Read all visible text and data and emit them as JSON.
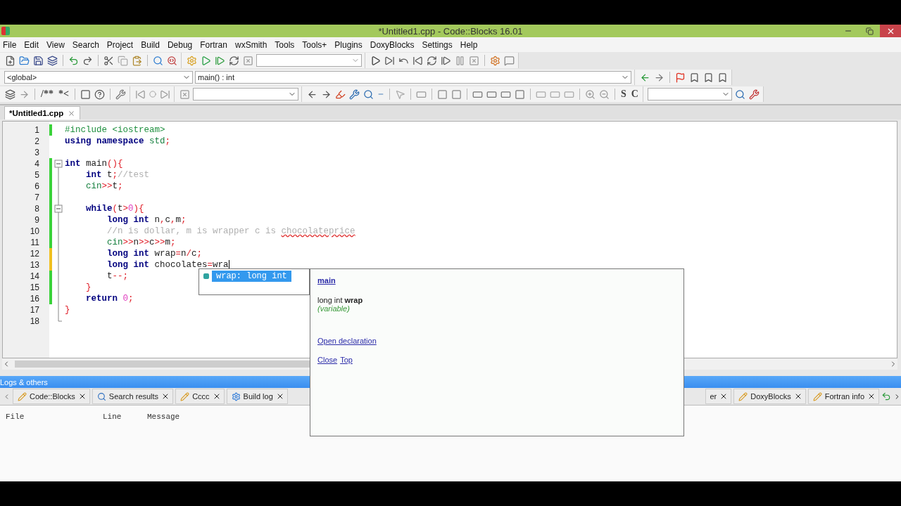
{
  "window": {
    "title": "*Untitled1.cpp - Code::Blocks 16.01"
  },
  "menu": [
    "File",
    "Edit",
    "View",
    "Search",
    "Project",
    "Build",
    "Debug",
    "Fortran",
    "wxSmith",
    "Tools",
    "Tools+",
    "Plugins",
    "DoxyBlocks",
    "Settings",
    "Help"
  ],
  "scope_bar": {
    "scope": "<global>",
    "function": "main() : int"
  },
  "toolbar_3": {
    "comment_buttons": [
      "/**",
      "*<"
    ],
    "letter_buttons": [
      "S",
      "C"
    ]
  },
  "editor_tabs": [
    {
      "label": "*Untitled1.cpp",
      "selected": true
    }
  ],
  "editor": {
    "lines": [
      {
        "number": "1",
        "modified": false,
        "tokens": [
          {
            "kind": "preprocessor",
            "text": "#include <iostream>"
          }
        ]
      },
      {
        "number": "2",
        "tokens": [
          {
            "kind": "keyword",
            "text": "using namespace "
          },
          {
            "kind": "library",
            "text": "std"
          },
          {
            "kind": "operator",
            "text": ";"
          }
        ]
      },
      {
        "number": "3"
      },
      {
        "number": "4",
        "modified": false,
        "fold": {
          "expanded": true
        },
        "tokens": [
          {
            "kind": "keyword",
            "text": "int"
          },
          {
            "kind": "plain",
            "text": " main"
          },
          {
            "kind": "operator",
            "text": "(){"
          }
        ]
      },
      {
        "number": "5",
        "modified": false,
        "tokens": [
          {
            "kind": "keyword",
            "text": "    int"
          },
          {
            "kind": "plain",
            "text": " t"
          },
          {
            "kind": "operator",
            "text": ";"
          },
          {
            "kind": "comment",
            "text": "//test"
          }
        ]
      },
      {
        "number": "6",
        "modified": false,
        "tokens": [
          {
            "kind": "library",
            "text": "    cin"
          },
          {
            "kind": "operator",
            "text": ">>"
          },
          {
            "kind": "plain",
            "text": "t"
          },
          {
            "kind": "operator",
            "text": ";"
          }
        ]
      },
      {
        "number": "7",
        "modified": false
      },
      {
        "number": "8",
        "modified": false,
        "fold": {
          "expanded": true
        },
        "tokens": [
          {
            "kind": "keyword",
            "text": "    while"
          },
          {
            "kind": "operator",
            "text": "("
          },
          {
            "kind": "plain",
            "text": "t"
          },
          {
            "kind": "operator",
            "text": ">"
          },
          {
            "kind": "number",
            "text": "0"
          },
          {
            "kind": "operator",
            "text": "){"
          }
        ]
      },
      {
        "number": "9",
        "modified": false,
        "tokens": [
          {
            "kind": "keyword",
            "text": "        long int"
          },
          {
            "kind": "plain",
            "text": " n"
          },
          {
            "kind": "operator",
            "text": ","
          },
          {
            "kind": "plain",
            "text": "c"
          },
          {
            "kind": "operator",
            "text": ","
          },
          {
            "kind": "plain",
            "text": "m"
          },
          {
            "kind": "operator",
            "text": ";"
          }
        ]
      },
      {
        "number": "10",
        "modified": false,
        "tokens": [
          {
            "kind": "comment",
            "text": "        //n is dollar, m is wrapper c is "
          },
          {
            "kind": "misspelled",
            "text": "chocolateprice"
          }
        ]
      },
      {
        "number": "11",
        "modified": false,
        "tokens": [
          {
            "kind": "library",
            "text": "        cin"
          },
          {
            "kind": "operator",
            "text": ">>"
          },
          {
            "kind": "plain",
            "text": "n"
          },
          {
            "kind": "operator",
            "text": ">>"
          },
          {
            "kind": "plain",
            "text": "c"
          },
          {
            "kind": "operator",
            "text": ">>"
          },
          {
            "kind": "plain",
            "text": "m"
          },
          {
            "kind": "operator",
            "text": ";"
          }
        ]
      },
      {
        "number": "12",
        "modified": true,
        "tokens": [
          {
            "kind": "keyword",
            "text": "        long int"
          },
          {
            "kind": "plain",
            "text": " wrap"
          },
          {
            "kind": "operator",
            "text": "="
          },
          {
            "kind": "plain",
            "text": "n"
          },
          {
            "kind": "operator",
            "text": "/"
          },
          {
            "kind": "plain",
            "text": "c"
          },
          {
            "kind": "operator",
            "text": ";"
          }
        ]
      },
      {
        "number": "13",
        "modified": true,
        "caret": true,
        "tokens": [
          {
            "kind": "keyword",
            "text": "        long int"
          },
          {
            "kind": "plain",
            "text": " chocolates"
          },
          {
            "kind": "operator",
            "text": "="
          },
          {
            "kind": "plain",
            "text": "wra"
          }
        ]
      },
      {
        "number": "14",
        "modified": false,
        "tokens": [
          {
            "kind": "plain",
            "text": "        t"
          },
          {
            "kind": "operator",
            "text": "--;"
          }
        ]
      },
      {
        "number": "15",
        "modified": false,
        "tokens": [
          {
            "kind": "operator",
            "text": "    }"
          }
        ]
      },
      {
        "number": "16",
        "modified": false,
        "tokens": [
          {
            "kind": "keyword",
            "text": "    return "
          },
          {
            "kind": "number",
            "text": "0"
          },
          {
            "kind": "operator",
            "text": ";"
          }
        ]
      },
      {
        "number": "17",
        "tokens": [
          {
            "kind": "operator",
            "text": "}"
          }
        ]
      },
      {
        "number": "18"
      }
    ]
  },
  "autocomplete": {
    "items": [
      {
        "label": "wrap: long int",
        "selected": true
      }
    ]
  },
  "doc_popup": {
    "scope_link": "main",
    "signature": "long int **wrap**",
    "category": "(variable)",
    "link": "Open declaration",
    "footer_links": [
      "Close",
      "Top"
    ]
  },
  "logs": {
    "title": "Logs & others",
    "tabs_left": [
      {
        "kind": "log",
        "label": "Code::Blocks"
      },
      {
        "kind": "search",
        "label": "Search results"
      },
      {
        "kind": "log",
        "label": "Cccc"
      },
      {
        "kind": "build",
        "label": "Build log"
      }
    ],
    "tabs_right": [
      {
        "kind": "partial",
        "label": "er"
      },
      {
        "kind": "log",
        "label": "DoxyBlocks"
      },
      {
        "kind": "log",
        "label": "Fortran info"
      }
    ],
    "columns": [
      "File",
      "Line",
      "Message"
    ]
  }
}
